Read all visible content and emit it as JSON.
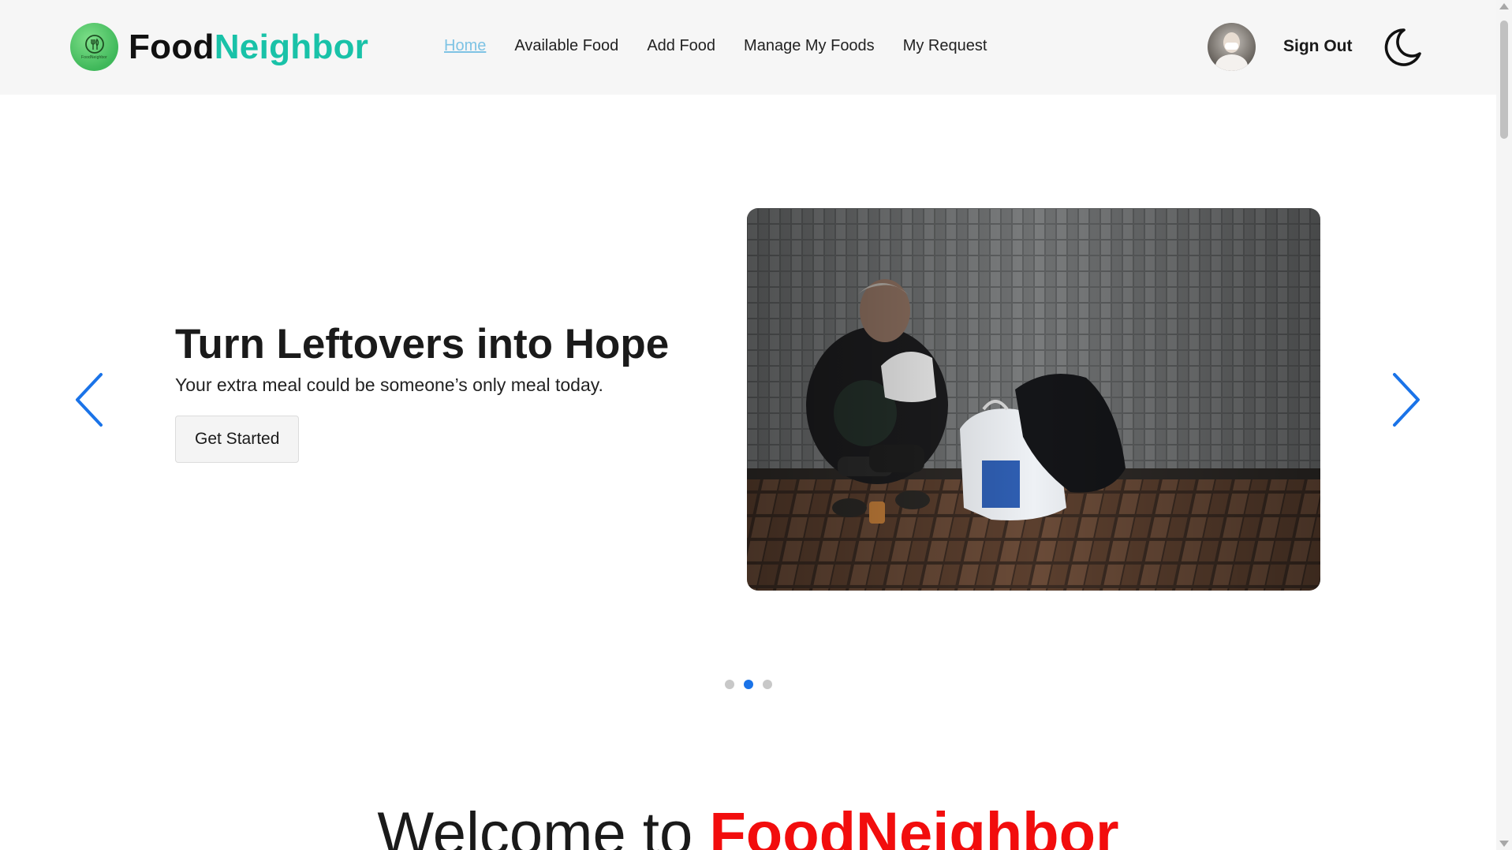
{
  "header": {
    "logo_word1": "Food",
    "logo_word2": "Neighbor",
    "logo_badge_text": "FoodNeighbor",
    "nav": [
      {
        "label": "Home",
        "active": true
      },
      {
        "label": "Available Food"
      },
      {
        "label": "Add Food"
      },
      {
        "label": "Manage My Foods"
      },
      {
        "label": "My Request"
      }
    ],
    "signout_label": "Sign Out",
    "theme_icon": "moon-icon",
    "avatar_icon": "user-avatar"
  },
  "hero": {
    "title": "Turn Leftovers into Hope",
    "subtitle": "Your extra meal could be someone’s only meal today.",
    "cta_label": "Get Started",
    "prev_icon": "chevron-left-icon",
    "next_icon": "chevron-right-icon",
    "slides_total": 3,
    "active_slide": 2
  },
  "welcome": {
    "prefix": "Welcome to ",
    "brand": "FoodNeighbor"
  },
  "colors": {
    "brand_teal": "#19c2a8",
    "active_link": "#7ec3e4",
    "carousel_arrow": "#1a73e8",
    "dot_active": "#1a73e8",
    "welcome_brand": "#f20d0d"
  }
}
